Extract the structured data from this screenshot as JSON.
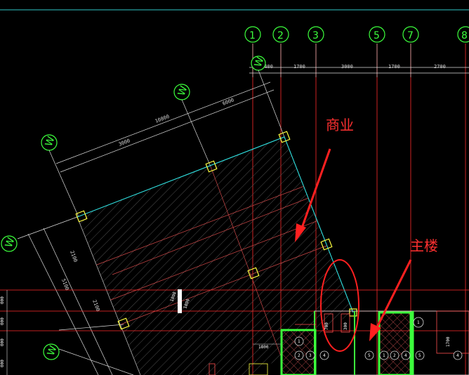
{
  "axis_bubbles_top": [
    "1",
    "2",
    "3",
    "5",
    "7",
    "8"
  ],
  "axis_bubble_rotated": [
    "W",
    "W",
    "W",
    "W",
    "W"
  ],
  "top_dimensions": [
    "1400",
    "1700",
    "3000",
    "1700",
    "2700"
  ],
  "diag_dimensions": [
    "3000",
    "10800",
    "6000"
  ],
  "left_dimensions": [
    "2100",
    "5100",
    "2100"
  ],
  "left_edge_dims": [
    "000",
    "000",
    "000",
    "000"
  ],
  "annotations": {
    "commerce": "商业",
    "main_building": "主楼"
  },
  "beam_label": "1800",
  "small_bubbles": [
    "1",
    "2",
    "3",
    "4",
    "5",
    "1",
    "4",
    "5",
    "1",
    "2",
    "4"
  ],
  "small_dims": [
    "1800",
    "700",
    "300",
    "1700"
  ],
  "colors": {
    "background": "#000000",
    "bubble": "#3cff3c",
    "red_line": "#ff2b2b",
    "cyan_line": "#30e0e0",
    "yellow_col": "#ffff40",
    "hatch": "#5a5a5a"
  }
}
